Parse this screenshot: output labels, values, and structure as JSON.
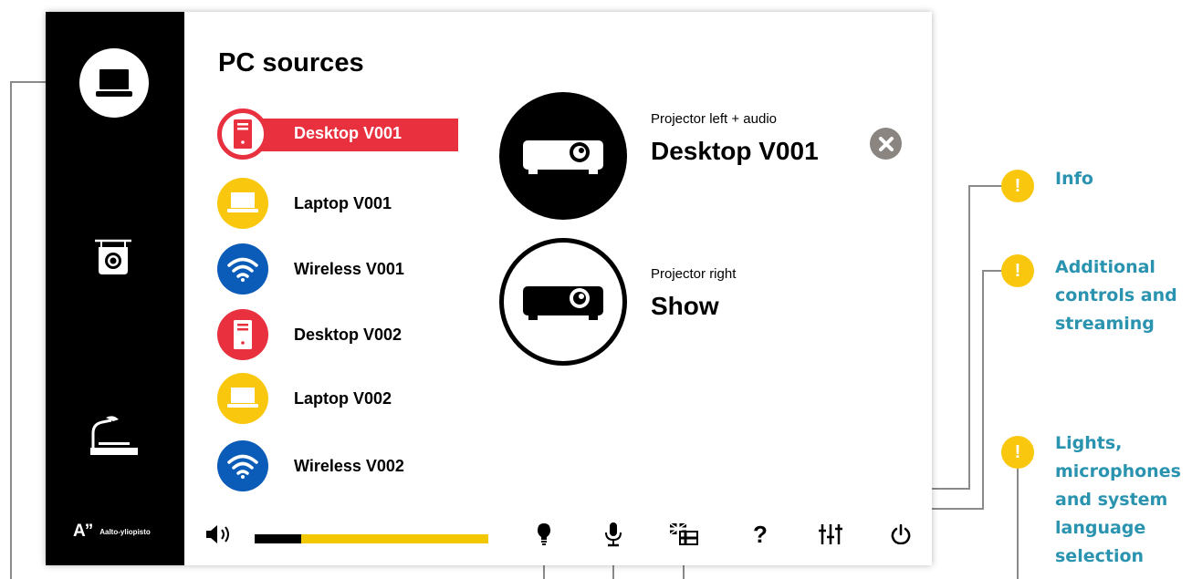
{
  "page_title": "PC sources",
  "sidebar": {
    "items": [
      {
        "name": "pc-sources",
        "icon": "laptop-icon"
      },
      {
        "name": "cameras",
        "icon": "ceiling-camera-icon"
      },
      {
        "name": "document-camera",
        "icon": "document-camera-icon"
      }
    ],
    "brand": {
      "logo": "A”",
      "name": "Aalto-yliopisto"
    }
  },
  "sources": [
    {
      "label": "Desktop V001",
      "type": "desktop",
      "color": "#e8303f",
      "selected": true
    },
    {
      "label": "Laptop V001",
      "type": "laptop",
      "color": "#f9c80e"
    },
    {
      "label": "Wireless V001",
      "type": "wireless",
      "color": "#0a5cb8"
    },
    {
      "label": "Desktop V002",
      "type": "desktop",
      "color": "#e8303f"
    },
    {
      "label": "Laptop V002",
      "type": "laptop",
      "color": "#f9c80e"
    },
    {
      "label": "Wireless V002",
      "type": "wireless",
      "color": "#0a5cb8"
    }
  ],
  "projectors": [
    {
      "name": "Projector left + audio",
      "source": "Desktop V001",
      "active": true
    },
    {
      "name": "Projector right",
      "source": "Show",
      "active": false
    }
  ],
  "volume": {
    "level": 0.2
  },
  "toolbar": {
    "items": [
      "bulb-icon",
      "microphone-icon",
      "language-flag-icon",
      "help-icon",
      "mixer-icon",
      "power-icon"
    ],
    "help_glyph": "?"
  },
  "annotations": [
    {
      "title": "Info",
      "marker": "!"
    },
    {
      "title": "Additional controls and streaming",
      "lines": [
        "Additional",
        "controls and",
        "streaming"
      ],
      "marker": "!"
    },
    {
      "title": "Lights, microphones and system language selection",
      "lines": [
        "Lights,",
        "microphones",
        "and system",
        "language",
        "selection"
      ],
      "marker": "!"
    }
  ],
  "colors": {
    "accent_red": "#e8303f",
    "yellow": "#f9c80e",
    "blue": "#0a5cb8",
    "annotation": "#2a93b0"
  }
}
